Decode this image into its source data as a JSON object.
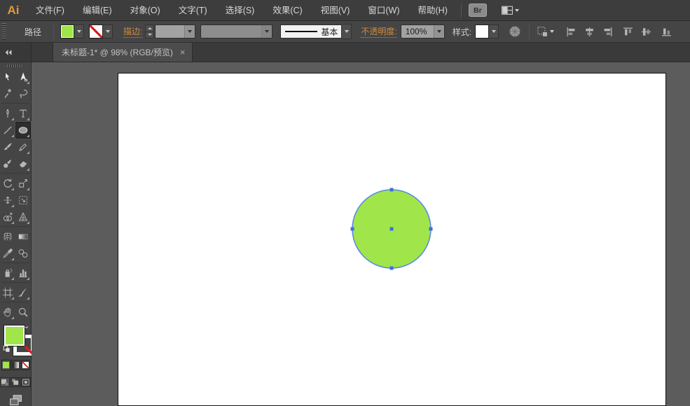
{
  "app": {
    "logo_text": "Ai"
  },
  "menubar": {
    "items": [
      {
        "key": "file",
        "label": "文件(F)"
      },
      {
        "key": "edit",
        "label": "编辑(E)"
      },
      {
        "key": "object",
        "label": "对象(O)"
      },
      {
        "key": "type",
        "label": "文字(T)"
      },
      {
        "key": "select",
        "label": "选择(S)"
      },
      {
        "key": "effect",
        "label": "效果(C)"
      },
      {
        "key": "view",
        "label": "视图(V)"
      },
      {
        "key": "window",
        "label": "窗口(W)"
      },
      {
        "key": "help",
        "label": "帮助(H)"
      }
    ],
    "bridge_button_label": "Br"
  },
  "control_bar": {
    "context_label": "路径",
    "stroke_label": "描边:",
    "brush_definition_value": "基本",
    "opacity_label": "不透明度:",
    "opacity_value": "100%",
    "style_label": "样式:",
    "align_buttons": [
      "horizontal-align-left",
      "horizontal-align-center",
      "horizontal-align-right",
      "vertical-align-top",
      "vertical-align-center",
      "vertical-align-bottom"
    ]
  },
  "document_tab": {
    "title": "未标题-1* @ 98% (RGB/预览)",
    "close_glyph": "×"
  },
  "toolbar": {
    "tools": [
      {
        "name": "selection-tool",
        "flyout": false,
        "selected": false
      },
      {
        "name": "direct-selection-tool",
        "flyout": true,
        "selected": false
      },
      {
        "name": "magic-wand-tool",
        "flyout": false,
        "selected": false
      },
      {
        "name": "lasso-tool",
        "flyout": false,
        "selected": false
      },
      {
        "name": "pen-tool",
        "flyout": true,
        "selected": false
      },
      {
        "name": "type-tool",
        "flyout": true,
        "selected": false
      },
      {
        "name": "line-segment-tool",
        "flyout": true,
        "selected": false
      },
      {
        "name": "ellipse-tool",
        "flyout": true,
        "selected": true
      },
      {
        "name": "paintbrush-tool",
        "flyout": false,
        "selected": false
      },
      {
        "name": "pencil-tool",
        "flyout": true,
        "selected": false
      },
      {
        "name": "blob-brush-tool",
        "flyout": false,
        "selected": false
      },
      {
        "name": "eraser-tool",
        "flyout": true,
        "selected": false
      },
      {
        "name": "rotate-tool",
        "flyout": true,
        "selected": false
      },
      {
        "name": "scale-tool",
        "flyout": true,
        "selected": false
      },
      {
        "name": "width-tool",
        "flyout": true,
        "selected": false
      },
      {
        "name": "free-transform-tool",
        "flyout": false,
        "selected": false
      },
      {
        "name": "shape-builder-tool",
        "flyout": true,
        "selected": false
      },
      {
        "name": "perspective-grid-tool",
        "flyout": true,
        "selected": false
      },
      {
        "name": "mesh-tool",
        "flyout": false,
        "selected": false
      },
      {
        "name": "gradient-tool",
        "flyout": false,
        "selected": false
      },
      {
        "name": "eyedropper-tool",
        "flyout": true,
        "selected": false
      },
      {
        "name": "blend-tool",
        "flyout": false,
        "selected": false
      },
      {
        "name": "symbol-sprayer-tool",
        "flyout": true,
        "selected": false
      },
      {
        "name": "column-graph-tool",
        "flyout": true,
        "selected": false
      },
      {
        "name": "artboard-tool",
        "flyout": true,
        "selected": false
      },
      {
        "name": "slice-tool",
        "flyout": true,
        "selected": false
      },
      {
        "name": "hand-tool",
        "flyout": true,
        "selected": false
      },
      {
        "name": "zoom-tool",
        "flyout": false,
        "selected": false
      }
    ]
  },
  "swatches": {
    "fill_color": "#A0E54A",
    "stroke_style": "none"
  },
  "canvas": {
    "artboard_color": "#FFFFFF",
    "shape": {
      "type": "ellipse",
      "fill": "#A0E54A",
      "selection_color": "#5585E8",
      "handle_color": "#3C6EE0"
    }
  },
  "colors": {
    "accent_orange": "#D08A3E",
    "selection_blue": "#5585E8",
    "fill_green": "#A0E54A",
    "pasteboard_gray": "#5C5C5C"
  }
}
